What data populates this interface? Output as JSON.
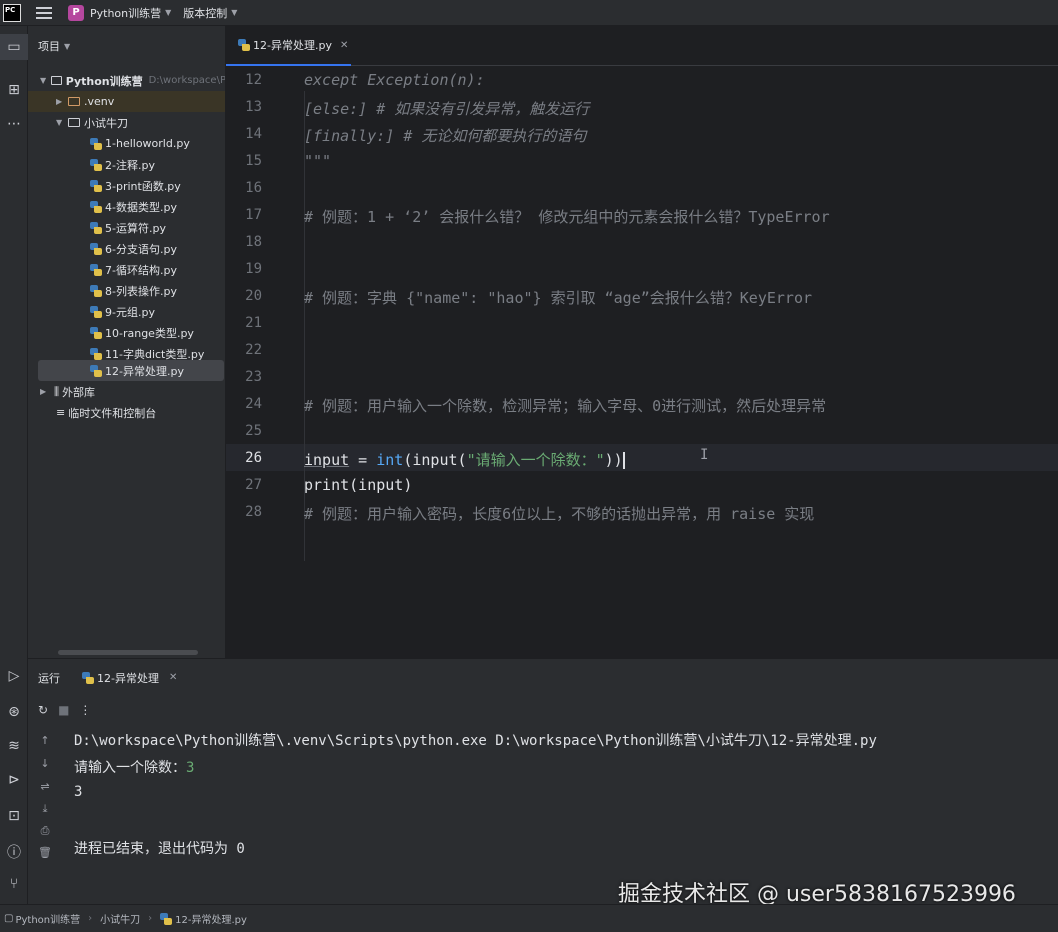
{
  "titlebar": {
    "logo": "PC",
    "project_badge": "P",
    "project_name": "Python训练营",
    "vcs": "版本控制"
  },
  "project_panel": {
    "header": "项目",
    "root": {
      "name": "Python训练营",
      "path": "D:\\workspace\\P"
    },
    "venv": ".venv",
    "folder": "小试牛刀",
    "files": [
      "1-helloworld.py",
      "2-注释.py",
      "3-print函数.py",
      "4-数据类型.py",
      "5-运算符.py",
      "6-分支语句.py",
      "7-循环结构.py",
      "8-列表操作.py",
      "9-元组.py",
      "10-range类型.py",
      "11-字典dict类型.py",
      "12-异常处理.py"
    ],
    "external_libs": "外部库",
    "scratches": "临时文件和控制台"
  },
  "editor": {
    "tab": "12-异常处理.py",
    "line_numbers": [
      "12",
      "13",
      "14",
      "15",
      "16",
      "17",
      "18",
      "19",
      "20",
      "21",
      "22",
      "23",
      "24",
      "25",
      "26",
      "27",
      "28"
    ],
    "current_line": "26",
    "code": {
      "l12": "except Exception(n):",
      "l13a": "[else:]",
      "l13b": " # 如果没有引发异常，触发运行",
      "l14a": "[finally:]",
      "l14b": " # 无论如何都要执行的语句",
      "l15": "\"\"\"",
      "l17": "# 例题：1 + ‘2’ 会报什么错？ 修改元组中的元素会报什么错？TypeError",
      "l20": "# 例题：字典 {\"name\": \"hao\"} 索引取 “age”会报什么错？KeyError",
      "l24": "# 例题：用户输入一个除数，检测异常；输入字母、0进行测试，然后处理异常",
      "l26_var": "input",
      "l26_eq": " = ",
      "l26_int": "int",
      "l26_open": "(input(",
      "l26_str": "\"请输入一个除数：\"",
      "l26_close": "))",
      "l27": "print(input)",
      "l28": "# 例题：用户输入密码，长度6位以上，不够的话抛出异常，用 raise 实现"
    }
  },
  "run_panel": {
    "title": "运行",
    "tab": "12-异常处理",
    "console": {
      "cmd": "D:\\workspace\\Python训练营\\.venv\\Scripts\\python.exe D:\\workspace\\Python训练营\\小试牛刀\\12-异常处理.py",
      "prompt": "请输入一个除数：",
      "prompt_input": "3",
      "output": "3",
      "exit": "进程已结束，退出代码为 0"
    }
  },
  "statusbar": {
    "crumbs": [
      "Python训练营",
      "小试牛刀",
      "12-异常处理.py"
    ]
  },
  "watermark": "掘金技术社区 @ user5838167523996",
  "colors": {
    "accent": "#3574f0",
    "keyword": "#cf8e6d",
    "string": "#6aab73",
    "comment": "#7a7e85"
  }
}
